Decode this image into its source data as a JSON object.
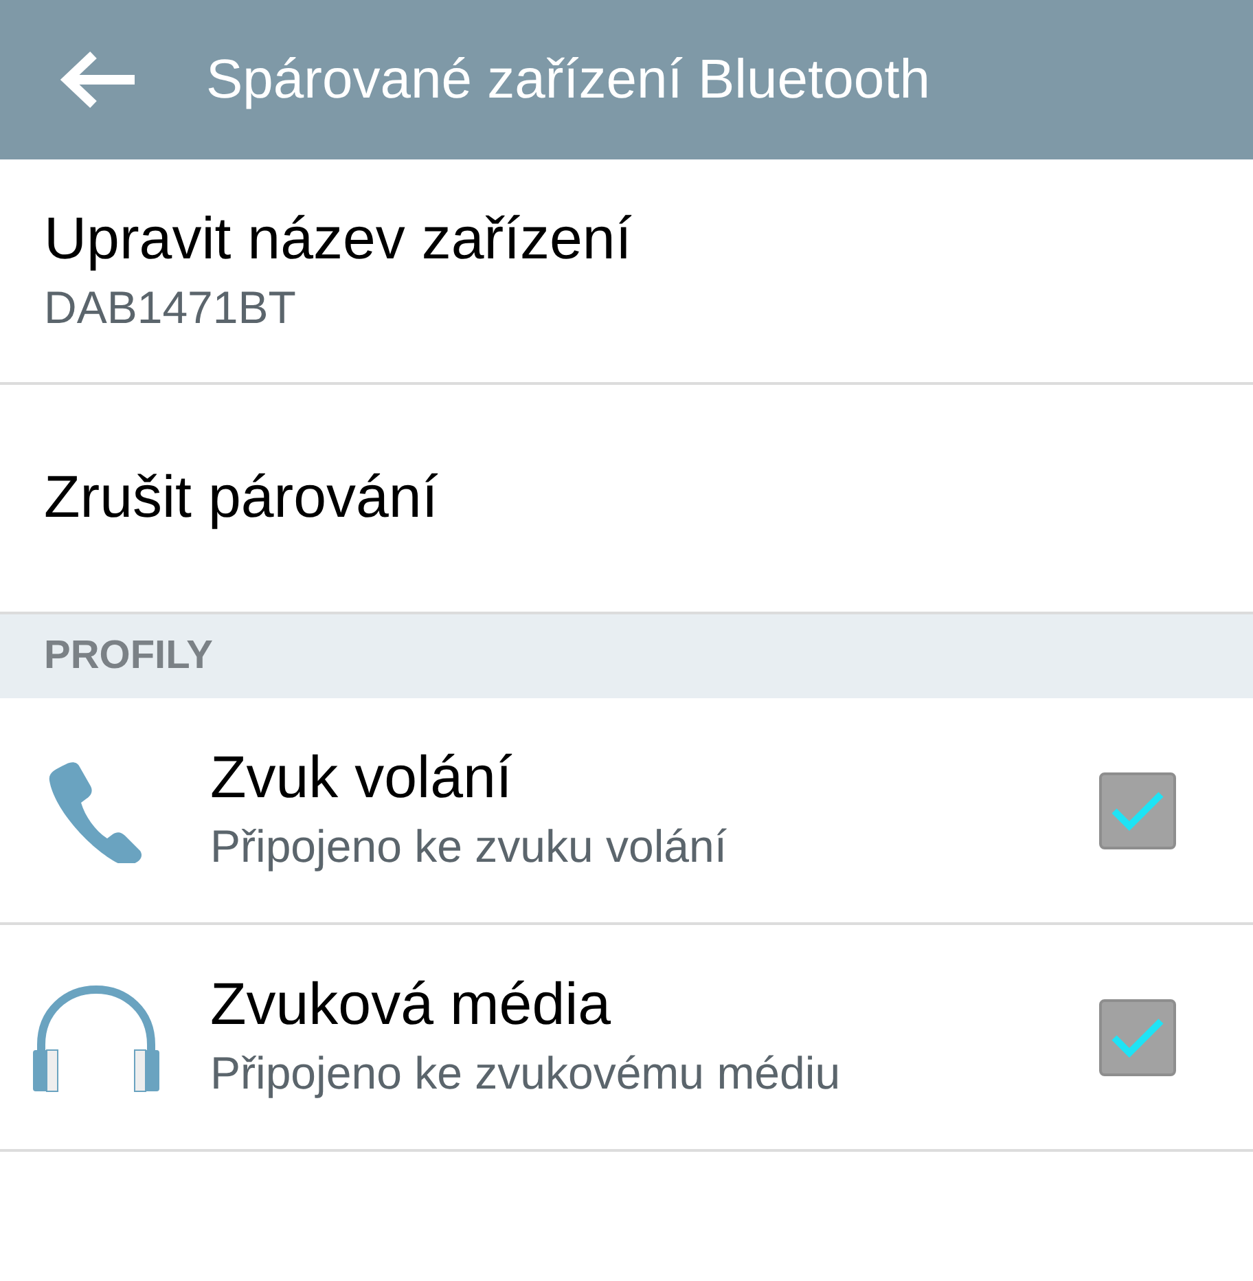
{
  "header": {
    "title": "Spárované zařízení Bluetooth"
  },
  "items": [
    {
      "title": "Upravit název zařízení",
      "summary": "DAB1471BT"
    },
    {
      "title": "Zrušit párování"
    }
  ],
  "section": {
    "title": "PROFILY"
  },
  "profiles": [
    {
      "kind": "phone",
      "title": "Zvuk volání",
      "summary": "Připojeno ke zvuku volání",
      "checked": true
    },
    {
      "kind": "headphones",
      "title": "Zvuková média",
      "summary": "Připojeno ke zvukovému médiu",
      "checked": true
    }
  ]
}
